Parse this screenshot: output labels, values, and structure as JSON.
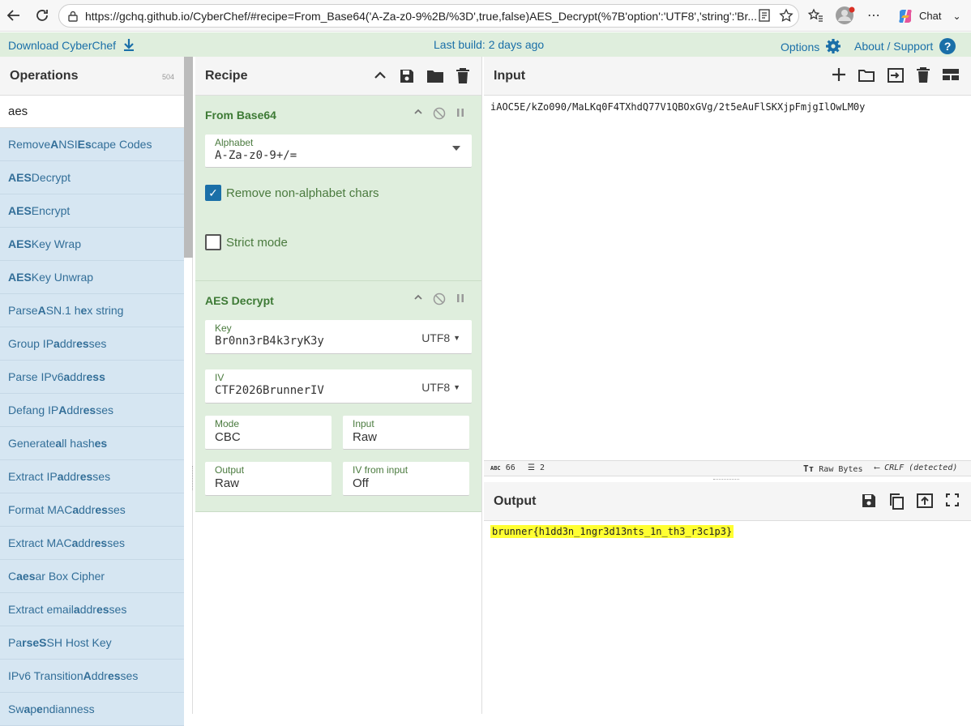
{
  "browser": {
    "url": "https://gchq.github.io/CyberChef/#recipe=From_Base64('A-Za-z0-9%2B/%3D',true,false)AES_Decrypt(%7B'option':'UTF8','string':'Br...",
    "chat_label": "Chat"
  },
  "banner": {
    "download": "Download CyberChef",
    "last_build": "Last build: 2 days ago",
    "options": "Options",
    "about": "About / Support"
  },
  "operations": {
    "title": "Operations",
    "count": "504",
    "search_value": "aes",
    "items": [
      {
        "pre": "Remove ",
        "b1": "A",
        "mid": "NSI ",
        "b2": "Es",
        "post": "cape Codes"
      },
      {
        "pre": "",
        "b1": "AES",
        "mid": " Decrypt",
        "b2": "",
        "post": ""
      },
      {
        "pre": "",
        "b1": "AES",
        "mid": " Encrypt",
        "b2": "",
        "post": ""
      },
      {
        "pre": "",
        "b1": "AES",
        "mid": " Key Wrap",
        "b2": "",
        "post": ""
      },
      {
        "pre": "",
        "b1": "AES",
        "mid": " Key Unwrap",
        "b2": "",
        "post": ""
      },
      {
        "pre": "Parse ",
        "b1": "A",
        "mid": "SN.1 h",
        "b2": "e",
        "post": "x string"
      },
      {
        "pre": "Group IP ",
        "b1": "a",
        "mid": "ddr",
        "b2": "es",
        "post": "ses"
      },
      {
        "pre": "Parse IPv6 ",
        "b1": "a",
        "mid": "ddr",
        "b2": "ess",
        "post": ""
      },
      {
        "pre": "Defang IP ",
        "b1": "A",
        "mid": "ddr",
        "b2": "es",
        "post": "ses"
      },
      {
        "pre": "Generate ",
        "b1": "a",
        "mid": "ll hash",
        "b2": "es",
        "post": ""
      },
      {
        "pre": "Extract IP ",
        "b1": "a",
        "mid": "ddr",
        "b2": "es",
        "post": "ses"
      },
      {
        "pre": "Format MAC ",
        "b1": "a",
        "mid": "ddr",
        "b2": "es",
        "post": "ses"
      },
      {
        "pre": "Extract MAC ",
        "b1": "a",
        "mid": "ddr",
        "b2": "es",
        "post": "ses"
      },
      {
        "pre": "C",
        "b1": "aes",
        "mid": "ar Box Cipher",
        "b2": "",
        "post": ""
      },
      {
        "pre": "Extract email ",
        "b1": "a",
        "mid": "ddr",
        "b2": "es",
        "post": "ses"
      },
      {
        "pre": "Pa",
        "b1": "rse",
        "mid": " ",
        "b2": "S",
        "post": "SH Host Key"
      },
      {
        "pre": "IPv6 Transition ",
        "b1": "A",
        "mid": "ddr",
        "b2": "es",
        "post": "ses"
      },
      {
        "pre": "Sw",
        "b1": "a",
        "mid": "p ",
        "b2": "e",
        "post": "ndianness"
      }
    ]
  },
  "recipe": {
    "title": "Recipe",
    "from_base64": {
      "title": "From Base64",
      "alphabet_label": "Alphabet",
      "alphabet_value": "A-Za-z0-9+/=",
      "remove_label": "Remove non-alphabet chars",
      "remove_checked": true,
      "strict_label": "Strict mode",
      "strict_checked": false
    },
    "aes_decrypt": {
      "title": "AES Decrypt",
      "key_label": "Key",
      "key_value": "Br0nn3rB4k3ryK3y",
      "key_encoding": "UTF8",
      "iv_label": "IV",
      "iv_value": "CTF2026BrunnerIV",
      "iv_encoding": "UTF8",
      "mode_label": "Mode",
      "mode_value": "CBC",
      "input_label": "Input",
      "input_value": "Raw",
      "output_label": "Output",
      "output_value": "Raw",
      "ivfrom_label": "IV from input",
      "ivfrom_value": "Off"
    }
  },
  "input": {
    "title": "Input",
    "text": "iAOC5E/kZo090/MaLKq0F4TXhdQ77V1QBOxGVg/2t5eAuFlSKXjpFmjgIlOwLM0y",
    "char_count": "66",
    "line_count": "2",
    "format": "Raw Bytes",
    "eol": "CRLF (detected)"
  },
  "output": {
    "title": "Output",
    "text": "brunner{h1dd3n_1ngr3d13nts_1n_th3_r3c1p3}"
  }
}
